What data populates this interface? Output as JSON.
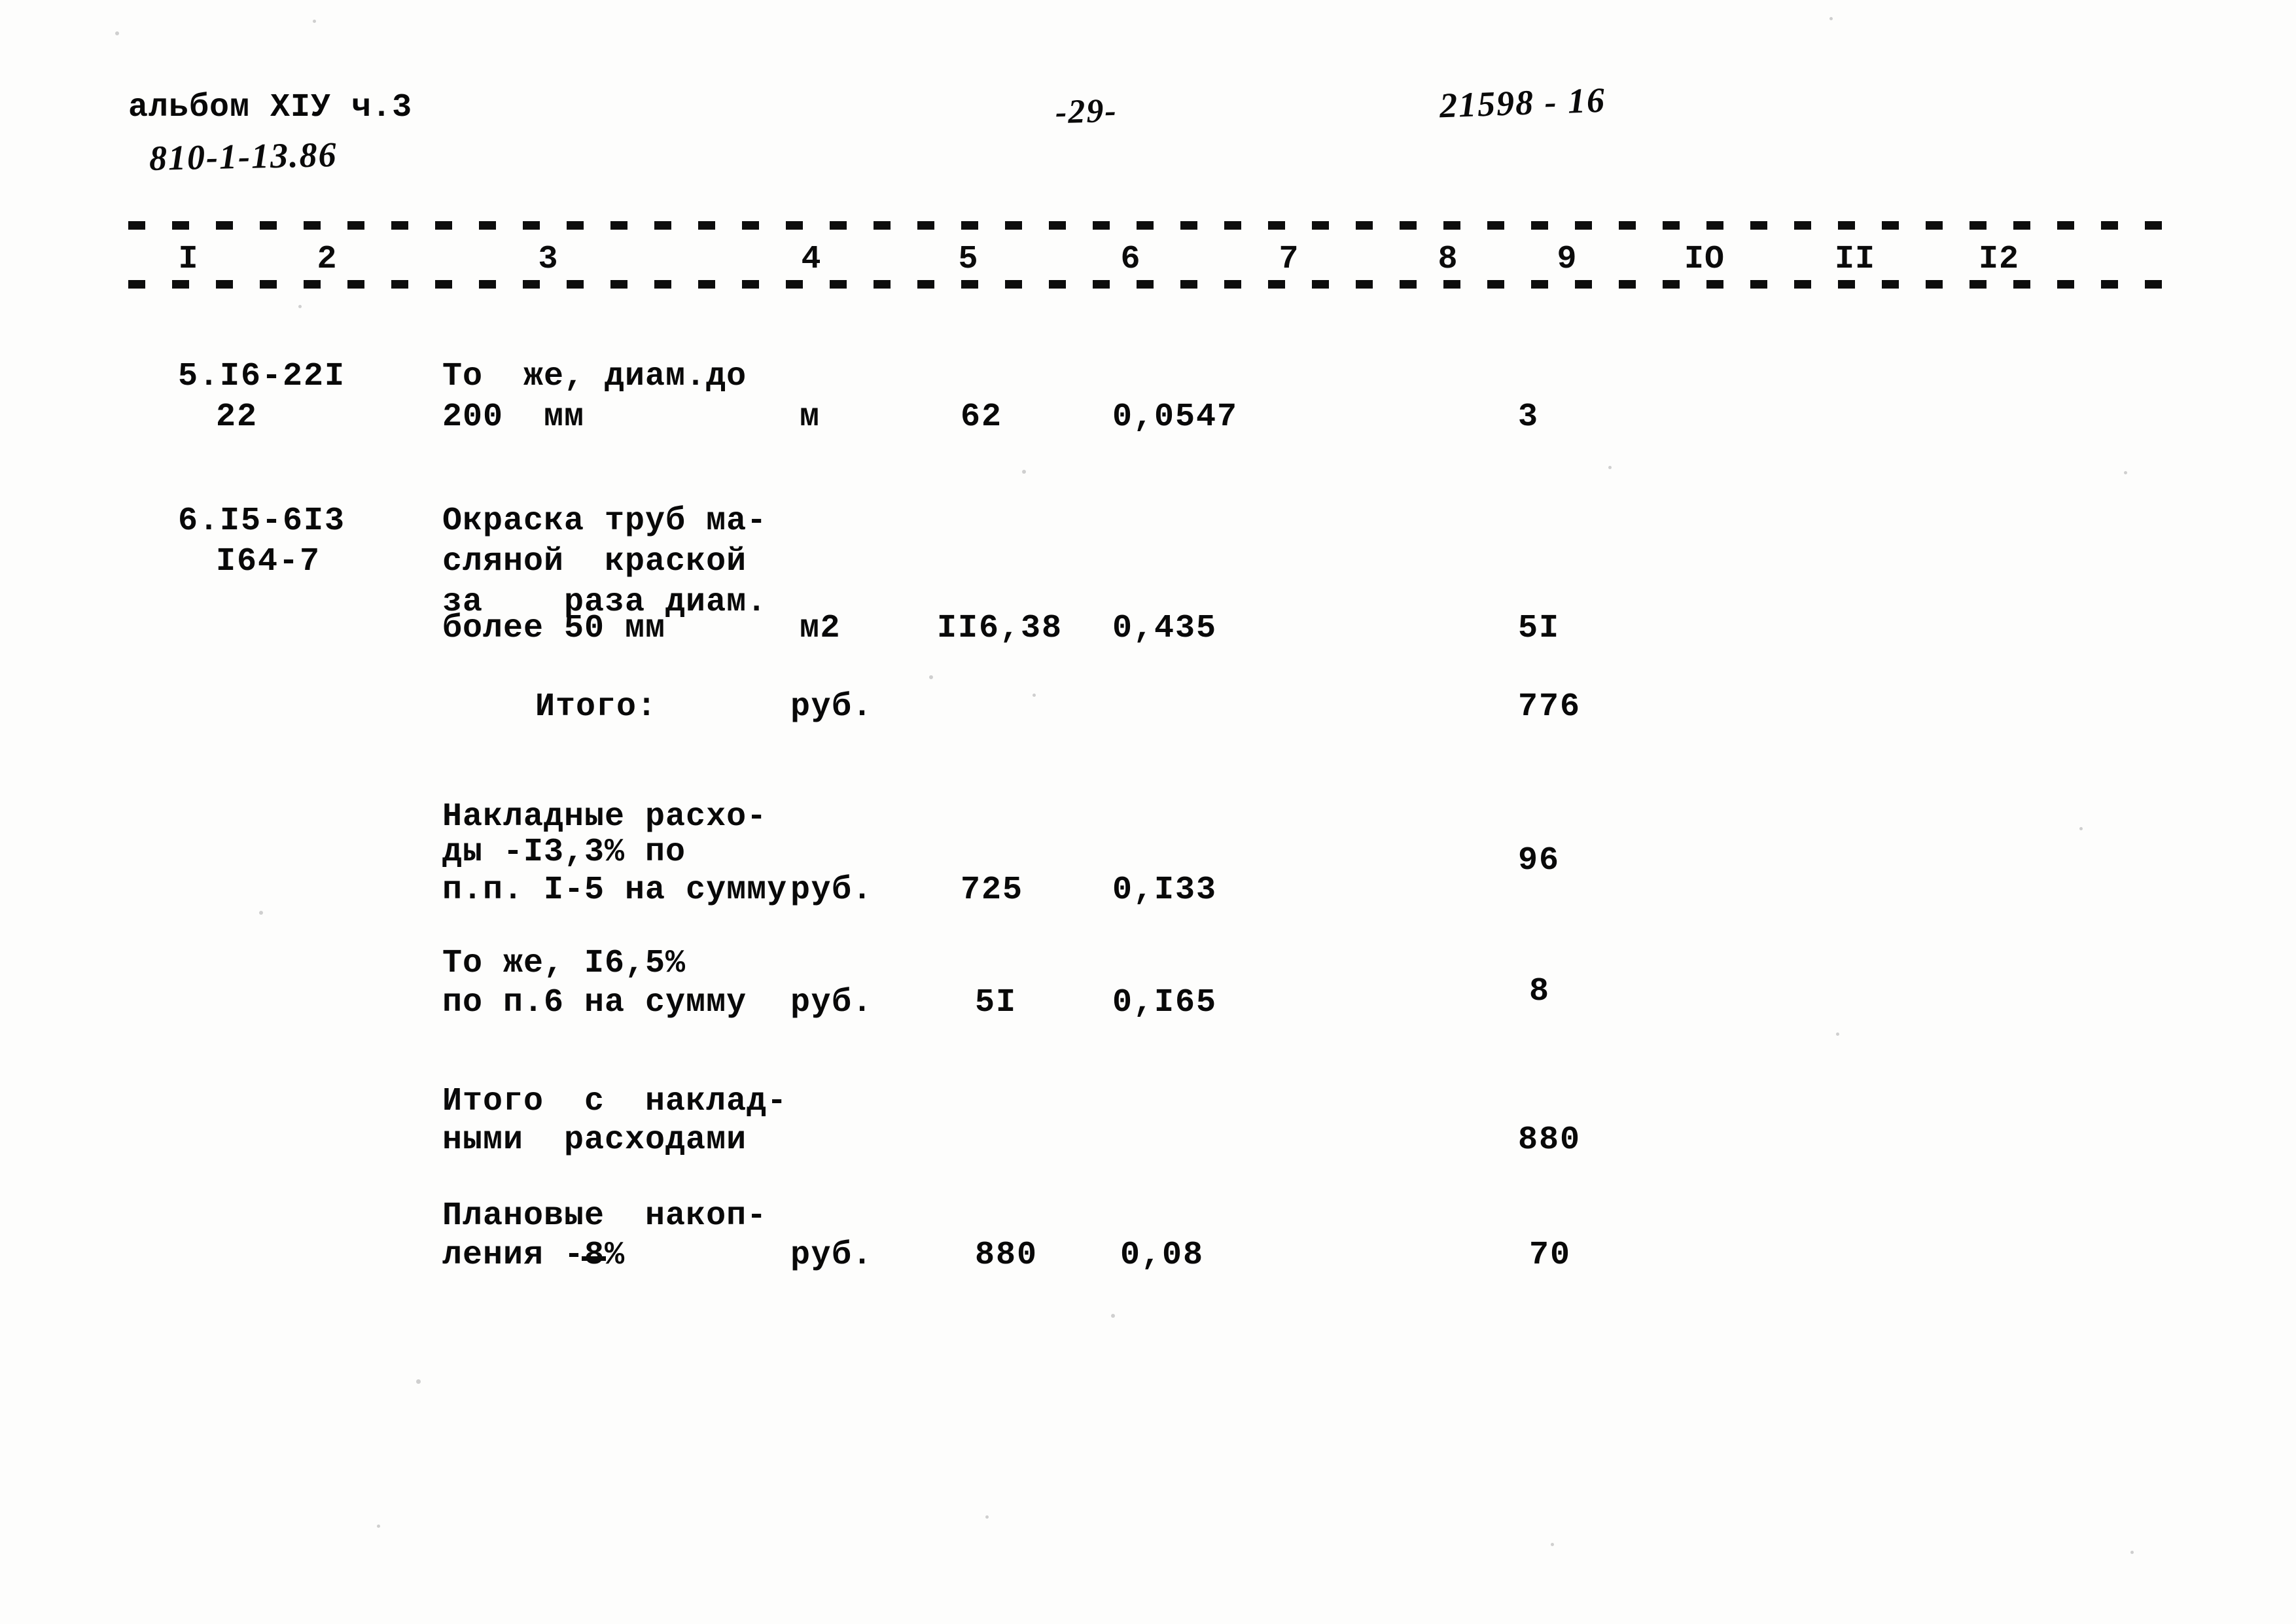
{
  "document": {
    "album_line": "альбом XIУ ч.3",
    "project_code": "810-1-13.86",
    "page_number": "-29-",
    "doc_code": "21598 - 16"
  },
  "table": {
    "column_numbers": [
      "I",
      "2",
      "3",
      "4",
      "5",
      "6",
      "7",
      "8",
      "9",
      "IO",
      "II",
      "I2"
    ],
    "rows": [
      {
        "code_line1": "5.I6-22I",
        "code_line2": "22",
        "desc_line1": "То  же, диам.до",
        "desc_line2": "200  мм",
        "unit": "м",
        "quantity": "62",
        "rate": "0,0547",
        "amount": "3"
      },
      {
        "code_line1": "6.I5-6I3",
        "code_line2": "I64-7",
        "desc_line1": "Окраска труб ма-",
        "desc_line2": "сляной  краской",
        "desc_line3": "за    раза диам.",
        "desc_line4": "более 50 мм",
        "unit": "м2",
        "quantity": "II6,38",
        "rate": "0,435",
        "amount": "5I"
      }
    ],
    "summary": [
      {
        "label_line1": "Итого:",
        "unit": "руб.",
        "quantity": "",
        "rate": "",
        "amount": "776"
      },
      {
        "label_line1": "Накладные расхо-",
        "label_line2": "ды -I3,3% по",
        "label_line3": "п.п. I-5 на сумму",
        "unit": "руб.",
        "quantity": "725",
        "rate": "0,I33",
        "amount": "96"
      },
      {
        "label_line1": "То же, I6,5%",
        "label_line2": "по п.6 на сумму",
        "unit": "руб.",
        "quantity": "5I",
        "rate": "0,I65",
        "amount": "8"
      },
      {
        "label_line1": "Итого  с  наклад-",
        "label_line2": "ными  расходами",
        "unit": "",
        "quantity": "",
        "rate": "",
        "amount": "880"
      },
      {
        "label_line1": "Плановые  накоп-",
        "label_line2_pre": "ления -",
        "label_line2_struck": "8",
        "label_line2_post": "%",
        "unit": "руб.",
        "quantity": "880",
        "rate": "0,08",
        "amount": "70"
      }
    ]
  }
}
